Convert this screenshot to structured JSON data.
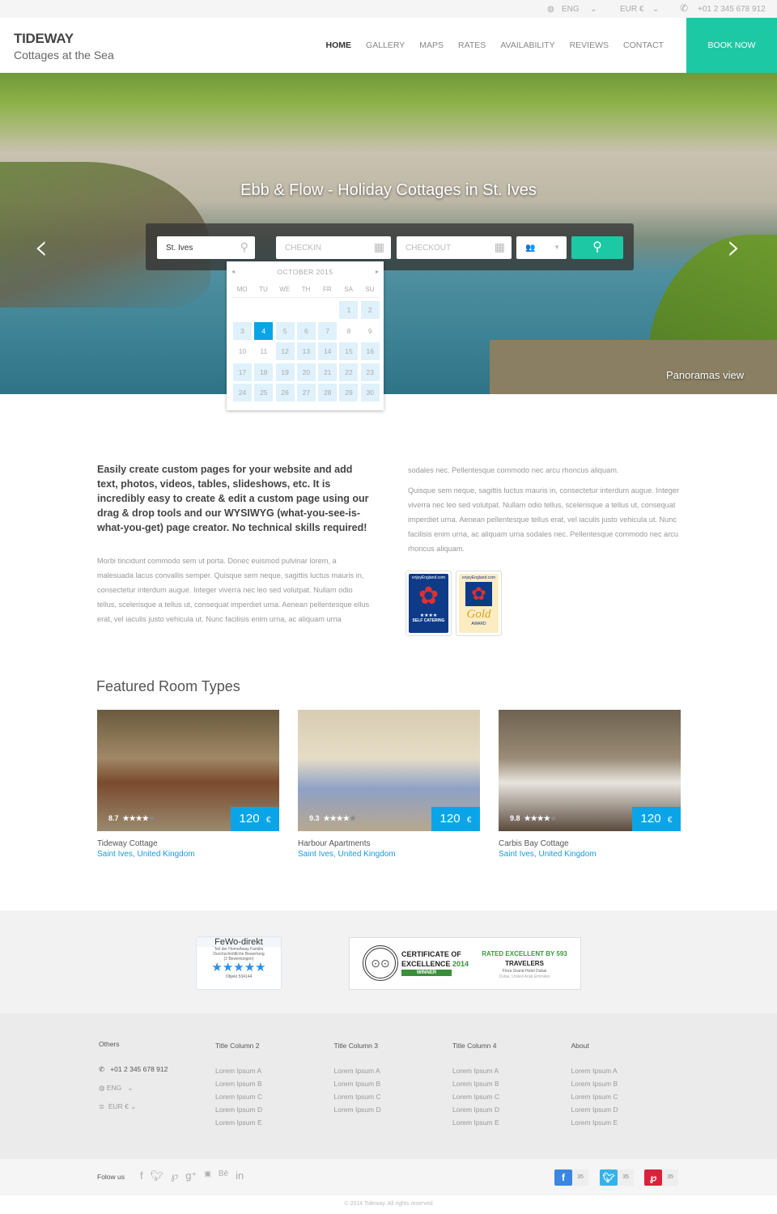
{
  "topbar": {
    "language": "ENG",
    "currency": "EUR €",
    "phone": "+01 2 345 678 912"
  },
  "header": {
    "title": "TIDEWAY",
    "subtitle": "Cottages at the Sea",
    "book_now": "BOOK NOW",
    "nav": [
      "HOME",
      "GALLERY",
      "MAPS",
      "RATES",
      "AVAILABILITY",
      "REVIEWS",
      "CONTACT"
    ],
    "active_nav": "HOME"
  },
  "hero": {
    "title": "Ebb & Flow - Holiday Cottages in St. Ives",
    "caption": "Panoramas view"
  },
  "search": {
    "location_value": "St. Ives",
    "checkin_placeholder": "CHECKIN",
    "checkout_placeholder": "CHECKOUT"
  },
  "calendar": {
    "month": "OCTOBER  2015",
    "days_of_week": [
      "MO",
      "TU",
      "WE",
      "TH",
      "FR",
      "SA",
      "SU"
    ],
    "weeks": [
      [
        null,
        null,
        null,
        null,
        null,
        1,
        2
      ],
      [
        3,
        4,
        5,
        6,
        7,
        8,
        9
      ],
      [
        10,
        11,
        12,
        13,
        14,
        15,
        16
      ],
      [
        17,
        18,
        19,
        20,
        21,
        22,
        23
      ],
      [
        24,
        25,
        26,
        27,
        28,
        29,
        30
      ]
    ],
    "selected": 4,
    "unavailable": [
      8,
      9,
      10,
      11
    ]
  },
  "content": {
    "intro": "Easily create custom pages for your website and add text, photos, videos, tables, slideshows, etc. It is incredibly easy to create & edit a custom page using our drag & drop tools and our WYSIWYG (what-you-see-is-what-you-get) page creator. No technical skills required!",
    "left_body": "Morbi tincidunt commodo sem ut porta. Donec euismod pulvinar lorem, a malesuada lacus convallis semper. Quisque sem neque, sagittis luctus mauris in, consectetur interdum augue. Integer viverra nec leo sed volutpat. Nullam odio tellus, scelerisque a tellus ut, consequat imperdiet urna. Aenean pellentesque ellus erat, vel iaculis justo vehicula ut. Nunc facilisis enim urna, ac aliquam urna",
    "right_p1": "sodales nec. Pellentesque commodo nec arcu rhoncus aliquam.",
    "right_p2": "Quisque sem neque, sagittis luctus mauris in, consectetur interdum augue. Integer viverra nec leo sed volutpat. Nullam odio tellus, scelerisque a tellus ut, consequat imperdiet urna. Aenean pellentesque tellus erat, vel iaculis justo vehicula ut. Nunc facilisis enim urna, ac aliquam urna sodales nec. Pellentesque commodo nec arcu rhoncus aliquam.",
    "badge1": {
      "brand": "enjoyEngland.com",
      "stars": "★★★★",
      "label": "SELF CATERING"
    },
    "badge2": {
      "brand": "enjoyEngland.com",
      "label": "Gold",
      "sub": "AWARD"
    }
  },
  "featured": {
    "title": "Featured Room Types",
    "rooms": [
      {
        "name": "Tideway Cottage",
        "location": "Saint Ives, United Kingdom",
        "rating": "8.7",
        "stars": 4,
        "price": "120",
        "currency": "€"
      },
      {
        "name": "Harbour Apartments",
        "location": "Saint Ives, United Kingdom",
        "rating": "9.3",
        "stars": 4,
        "price": "120",
        "currency": "€"
      },
      {
        "name": "Carbis Bay Cottage",
        "location": "Saint Ives, United Kingdom",
        "rating": "9.8",
        "stars": 4,
        "price": "120",
        "currency": "€"
      }
    ]
  },
  "awards": {
    "fewo": {
      "brand": "FeWo-direkt",
      "tag": "Teil der HomeAway Familie",
      "line1": "Durchschnittliche Bewertung",
      "line2": "(2 Bewertungen)",
      "stars": "★★★★★",
      "object": "Objekt 534144"
    },
    "tripadvisor": {
      "cert1": "CERTIFICATE OF",
      "cert2": "EXCELLENCE",
      "year": "2014",
      "winner": "WINNER",
      "rated": "RATED EXCELLENT BY 593",
      "travelers": "TRAVELERS",
      "hotel": "Flora Grand Hotel Dubai",
      "place": "Dubai, United Arab Emirates"
    }
  },
  "footer": {
    "others": {
      "title": "Others",
      "phone": "+01 2 345 678 912",
      "language": "ENG",
      "currency": "EUR €"
    },
    "columns": [
      {
        "title": "Title Column 2",
        "items": [
          "Lorem Ipsum A",
          "Lorem Ipsum B",
          "Lorem Ipsum C",
          "Lorem Ipsum D",
          "Lorem Ipsum E"
        ]
      },
      {
        "title": "Title Column 3",
        "items": [
          "Lorem Ipsum A",
          "Lorem Ipsum B",
          "Lorem Ipsum C",
          "Lorem Ipsum D"
        ]
      },
      {
        "title": "Title Column 4",
        "items": [
          "Lorem Ipsum A",
          "Lorem Ipsum B",
          "Lorem Ipsum C",
          "Lorem Ipsum D",
          "Lorem Ipsum E"
        ]
      },
      {
        "title": "About",
        "items": [
          "Lorem Ipsum A",
          "Lorem Ipsum B",
          "Lorem Ipsum C",
          "Lorem Ipsum D",
          "Lorem Ipsum E"
        ]
      }
    ]
  },
  "social": {
    "follow": "Folow us",
    "icons": [
      "facebook-icon",
      "twitter-icon",
      "pinterest-icon",
      "google-plus-icon",
      "youtube-icon",
      "behance-icon",
      "linkedin-icon"
    ],
    "shares": [
      {
        "network": "facebook",
        "count": "35",
        "color": "#3b86e0"
      },
      {
        "network": "twitter",
        "count": "35",
        "color": "#35b2e8"
      },
      {
        "network": "pinterest",
        "count": "35",
        "color": "#d8233a"
      }
    ]
  },
  "copyright": "© 2014 Tideway. All rights reserved",
  "colors": {
    "accent": "#1dc8a4",
    "blue": "#0aa5e8"
  }
}
